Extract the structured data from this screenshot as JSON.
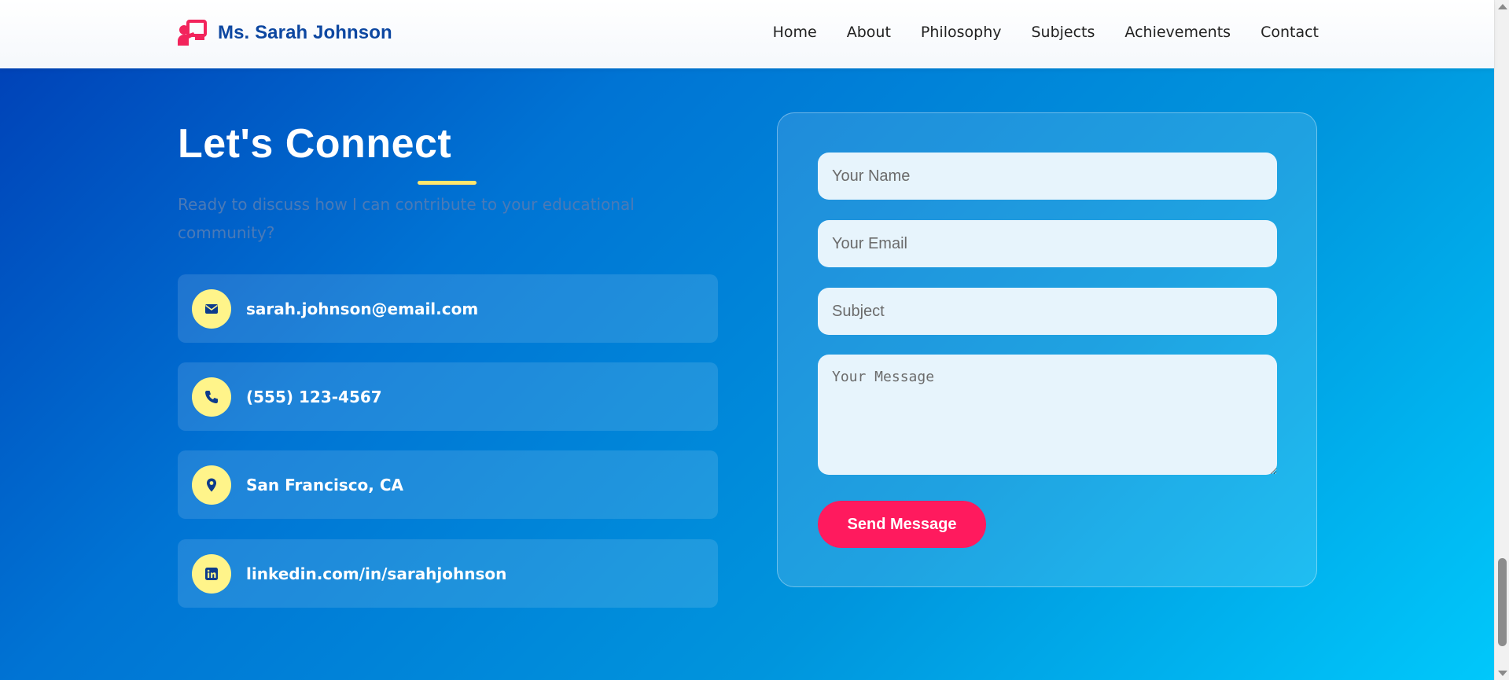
{
  "brand": {
    "name": "Ms. Sarah Johnson",
    "icon": "teacher-board-icon",
    "color": "#0d47a1",
    "icon_color": "#f2245c"
  },
  "nav": {
    "items": [
      {
        "label": "Home"
      },
      {
        "label": "About"
      },
      {
        "label": "Philosophy"
      },
      {
        "label": "Subjects"
      },
      {
        "label": "Achievements"
      },
      {
        "label": "Contact"
      }
    ]
  },
  "contact": {
    "title": "Let's Connect",
    "subtitle": "Ready to discuss how I can contribute to your educational community?",
    "accent_color": "#ffe66d",
    "info": [
      {
        "icon": "envelope-icon",
        "text": "sarah.johnson@email.com"
      },
      {
        "icon": "phone-icon",
        "text": "(555) 123-4567"
      },
      {
        "icon": "map-pin-icon",
        "text": "San Francisco, CA"
      },
      {
        "icon": "linkedin-icon",
        "text": "linkedin.com/in/sarahjohnson"
      }
    ]
  },
  "form": {
    "name_placeholder": "Your Name",
    "email_placeholder": "Your Email",
    "subject_placeholder": "Subject",
    "message_placeholder": "Your Message",
    "submit_label": "Send Message",
    "submit_color": "#ff1a5e"
  }
}
